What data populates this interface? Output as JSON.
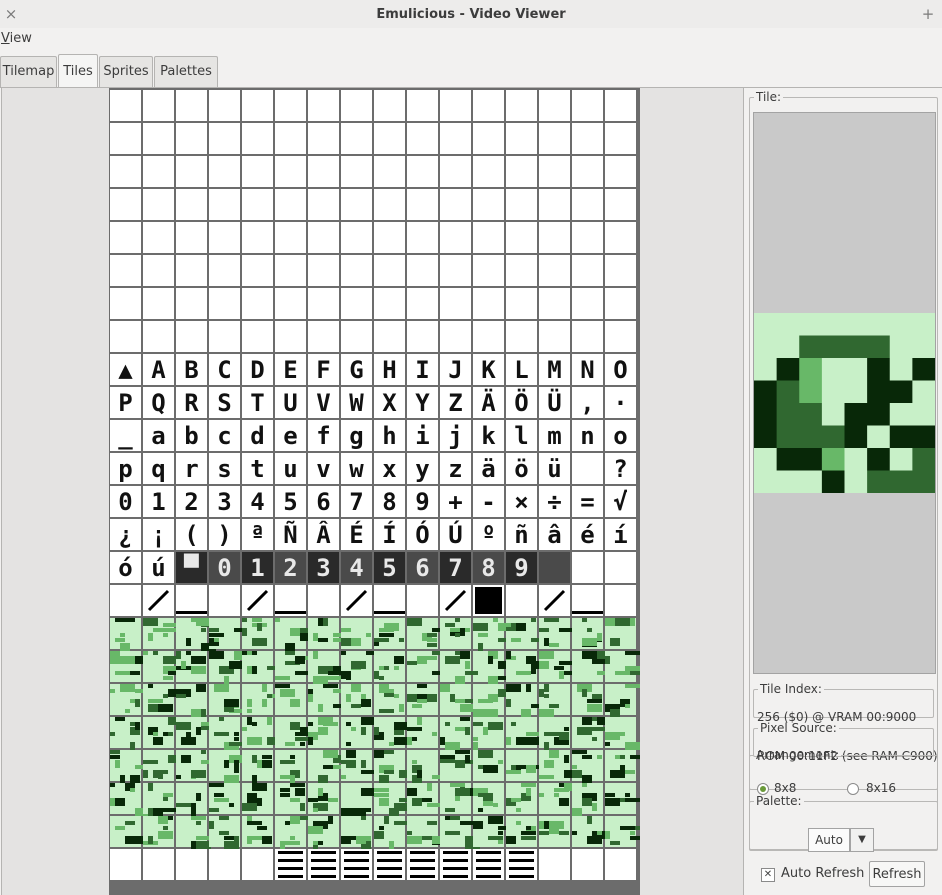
{
  "window": {
    "title": "Emulicious - Video Viewer",
    "close_glyph": "×",
    "expand_glyph": "+"
  },
  "menu": {
    "view_label": "View",
    "view_mnemonic": "V",
    "view_rest": "iew"
  },
  "tabs": [
    {
      "label": "Tilemap",
      "active": false
    },
    {
      "label": "Tiles",
      "active": true
    },
    {
      "label": "Sprites",
      "active": false
    },
    {
      "label": "Palettes",
      "active": false
    }
  ],
  "tile_panel": {
    "legend": "Tile:",
    "index_legend": "Tile Index:",
    "index_value": "256 ($0) @ VRAM 00:9000",
    "source_legend": "Pixel Source:",
    "source_value": "ROM 00:11F2 (see RAM C900)"
  },
  "arrangement": {
    "legend": "Arrangement:",
    "options": [
      {
        "label": "8x8",
        "selected": true
      },
      {
        "label": "8x16",
        "selected": false
      }
    ]
  },
  "palette": {
    "legend": "Palette:",
    "selected": "Auto",
    "drop_glyph": "▼"
  },
  "auto_refresh": {
    "label": "Auto Refresh",
    "checked": true,
    "check_glyph": "✕"
  },
  "refresh_label": "Refresh",
  "colors": {
    "lightest": "#c8f0c8",
    "light": "#68b868",
    "dark": "#306830",
    "darkest": "#082808",
    "grid": "#6c6c6c"
  },
  "tile_rows": [
    {
      "text": "",
      "style": "blank"
    },
    {
      "text": "",
      "style": "blank"
    },
    {
      "text": "",
      "style": "blank"
    },
    {
      "text": "",
      "style": "blank"
    },
    {
      "text": "",
      "style": "blank"
    },
    {
      "text": "",
      "style": "blank"
    },
    {
      "text": "",
      "style": "blank"
    },
    {
      "text": "",
      "style": "blank"
    },
    {
      "text": "▲ABCDEFGHIJKLMNO",
      "style": "text"
    },
    {
      "text": "PQRSTUVWXYZÄÖÜ,·",
      "style": "text"
    },
    {
      "text": "_abcdefghijklmno",
      "style": "text"
    },
    {
      "text": "pqrstuvwxyzäöü ?",
      "style": "text"
    },
    {
      "text": "0123456789+-×÷=√",
      "style": "text"
    },
    {
      "text": "¿¡()ªÑÂÉÍÓÚºñâéí",
      "style": "text"
    },
    {
      "text": "óú▀0123456789  ",
      "style": "digits"
    },
    {
      "text": "",
      "style": "shapes"
    },
    {
      "text": "",
      "style": "green"
    },
    {
      "text": "",
      "style": "green"
    },
    {
      "text": "",
      "style": "green"
    },
    {
      "text": "",
      "style": "green"
    },
    {
      "text": "",
      "style": "green"
    },
    {
      "text": "",
      "style": "green"
    },
    {
      "text": "",
      "style": "green"
    },
    {
      "text": "",
      "style": "bars"
    }
  ],
  "big_tile_pixels": [
    "00000000",
    "00222200",
    "03100303",
    "32100330",
    "32203300",
    "32223033",
    "03310302",
    "00030222"
  ]
}
